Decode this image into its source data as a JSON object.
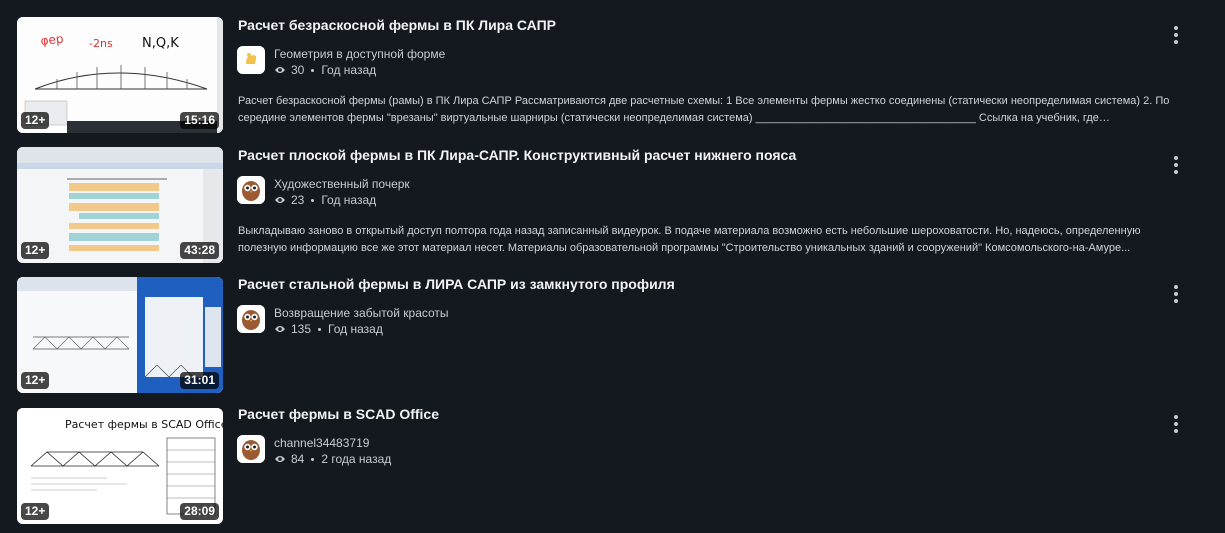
{
  "videos": [
    {
      "title": "Расчет безраскосной фермы в ПК Лира САПР",
      "channel": "Геометрия в доступной форме",
      "views": "30",
      "age": "Год назад",
      "description": "Расчет безраскосной фермы (рамы) в ПК Лира САПР Рассматриваются две расчетные схемы: 1 Все элементы фермы жестко соединены (статически неопределимая система) 2. По середине элементов фермы \"врезаны\" виртуальные шарниры (статически неопределимая система) ____________________________________ Ссылка на учебник, где рассматривается...",
      "age_rating": "12+",
      "duration": "15:16"
    },
    {
      "title": "Расчет плоской фермы в ПК Лира-САПР. Конструктивный расчет нижнего пояса",
      "channel": "Художественный почерк",
      "views": "23",
      "age": "Год назад",
      "description": "Выкладываю заново в открытый доступ полтора года назад записанный видеурок. В подаче материала возможно есть небольшие шероховатости. Но, надеюсь, определенную полезную информацию все же этот материал несет. Материалы образовательной программы \"Строительство уникальных зданий и сооружений\" Комсомольского-на-Амуре...",
      "age_rating": "12+",
      "duration": "43:28"
    },
    {
      "title": "Расчет стальной фермы в ЛИРА САПР из замкнутого профиля",
      "channel": "Возвращение забытой красоты",
      "views": "135",
      "age": "Год назад",
      "description": "",
      "age_rating": "12+",
      "duration": "31:01"
    },
    {
      "title": "Расчет фермы в SCAD Office",
      "channel": "channel34483719",
      "views": "84",
      "age": "2 года назад",
      "description": "",
      "age_rating": "12+",
      "duration": "28:09",
      "thumb_heading": "Расчет фермы в SCAD Office"
    }
  ],
  "colors": {
    "background": "#14191f",
    "text": "#f1f3f4",
    "muted": "#c8ccd1"
  },
  "icons": {
    "views": "eye-icon",
    "more": "more-vertical-icon"
  }
}
